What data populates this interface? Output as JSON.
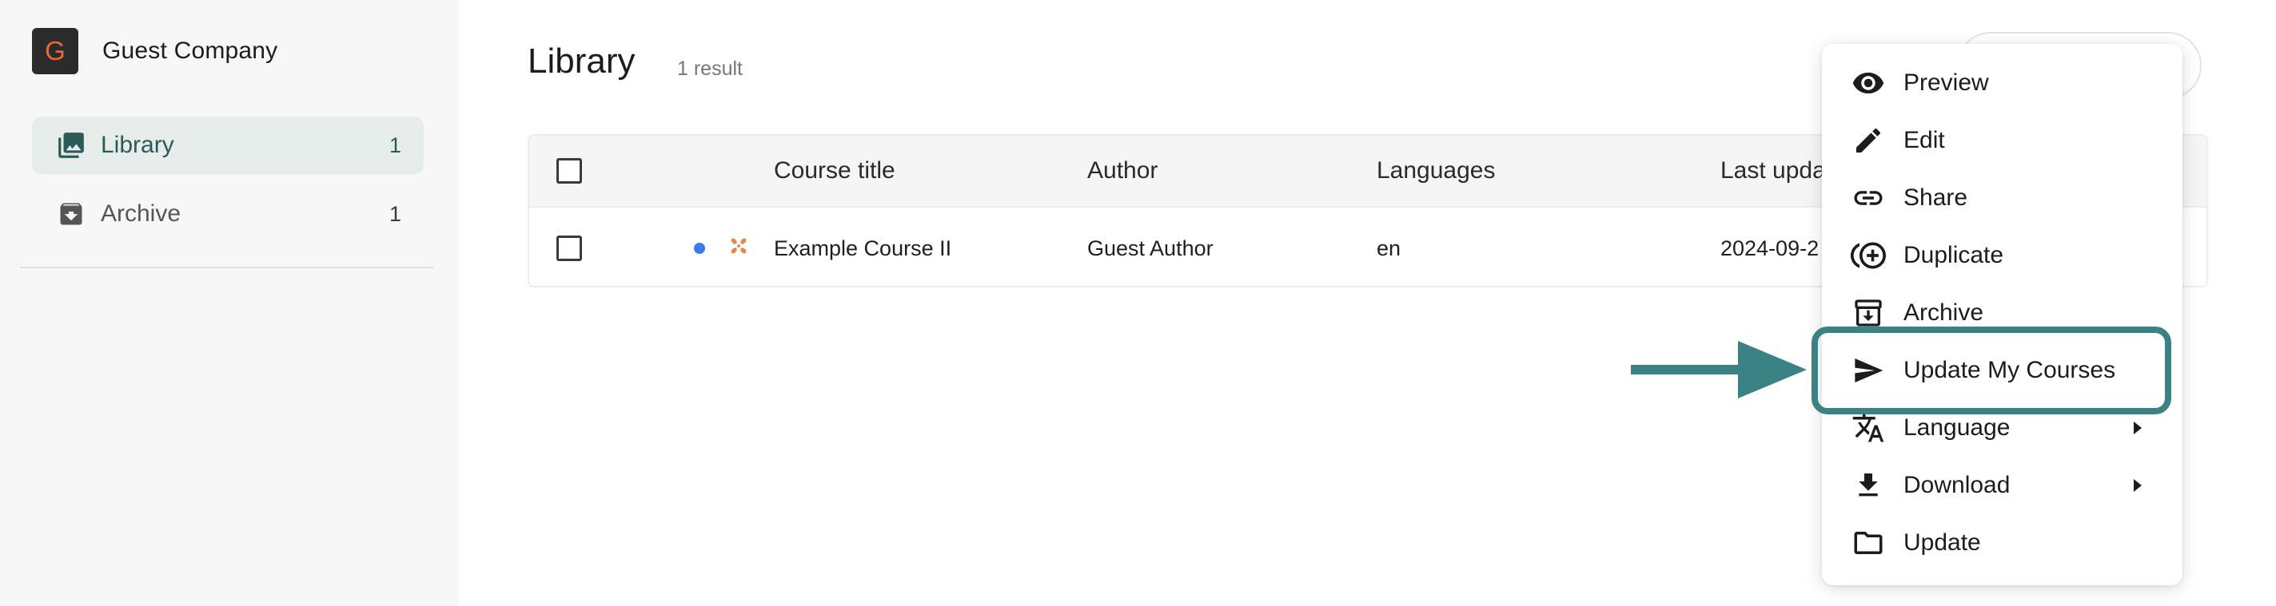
{
  "company": {
    "logo_letter": "G",
    "name": "Guest Company"
  },
  "sidebar": {
    "items": [
      {
        "label": "Library",
        "count": "1",
        "icon": "library-images-icon"
      },
      {
        "label": "Archive",
        "count": "1",
        "icon": "archive-box-icon"
      }
    ]
  },
  "main": {
    "title": "Library",
    "result_count": "1 result"
  },
  "table": {
    "columns": [
      "Course title",
      "Author",
      "Languages",
      "Last upda"
    ],
    "rows": [
      {
        "title": "Example Course II",
        "author": "Guest Author",
        "languages": "en",
        "last_updated": "2024-09-2"
      }
    ]
  },
  "context_menu": {
    "items": [
      {
        "label": "Preview",
        "icon": "eye-icon"
      },
      {
        "label": "Edit",
        "icon": "pencil-icon"
      },
      {
        "label": "Share",
        "icon": "link-icon"
      },
      {
        "label": "Duplicate",
        "icon": "duplicate-plus-icon"
      },
      {
        "label": "Archive",
        "icon": "archive-icon"
      },
      {
        "label": "Update My Courses",
        "icon": "send-icon"
      },
      {
        "label": "Language",
        "icon": "translate-icon",
        "submenu": true
      },
      {
        "label": "Download",
        "icon": "download-icon",
        "submenu": true
      },
      {
        "label": "Update",
        "icon": "folder-icon"
      }
    ]
  },
  "colors": {
    "accent_teal": "#3a8283",
    "active_nav_bg": "#e6ecea",
    "active_nav_text": "#2b5a57",
    "logo_bg": "#2b2b2b",
    "logo_letter": "#e8683a",
    "status_dot": "#3d7be8",
    "course_icon": "#e8874a"
  }
}
